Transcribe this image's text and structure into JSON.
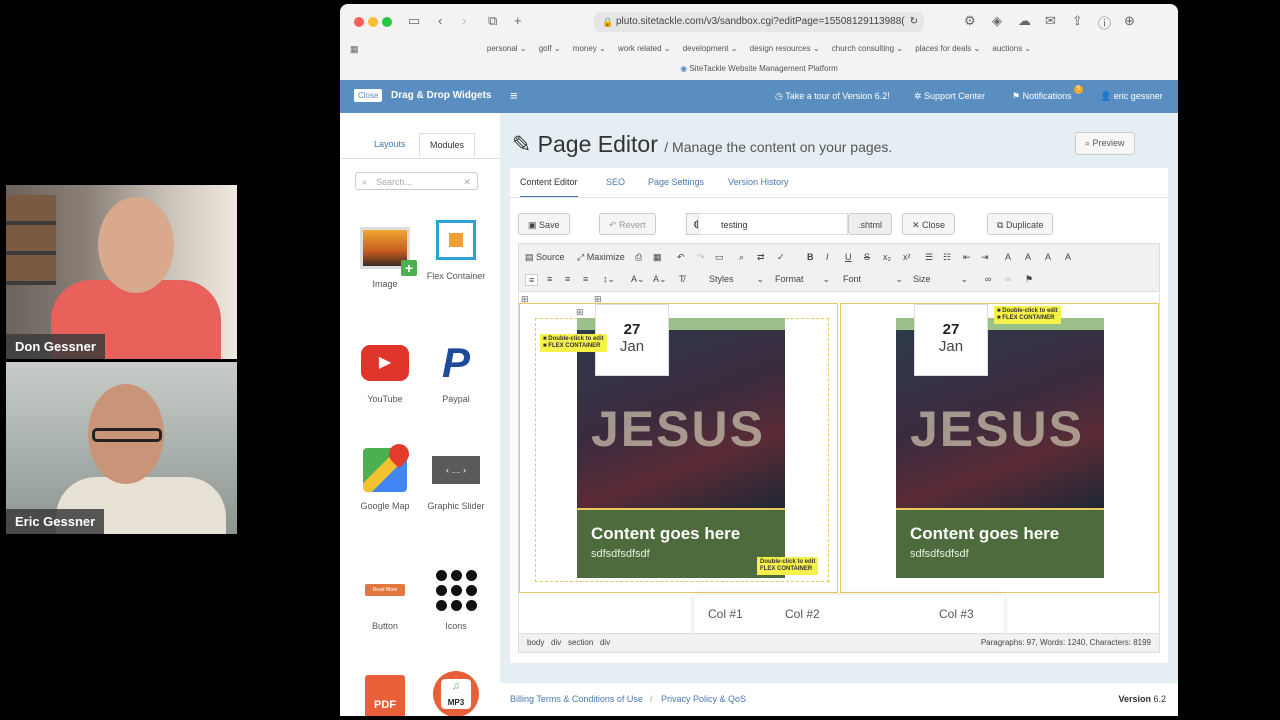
{
  "participants": [
    {
      "name": "Don Gessner"
    },
    {
      "name": "Eric Gessner"
    }
  ],
  "browser": {
    "url": "pluto.sitetackle.com/v3/sandbox.cgi?editPage=15508129113988(",
    "bookmarks": [
      "personal ⌄",
      "golf ⌄",
      "money ⌄",
      "work related ⌄",
      "development ⌄",
      "design resources ⌄",
      "church consulting ⌄",
      "places for deals ⌄",
      "auctions ⌄"
    ],
    "platform_title": "SiteTackle Website Management Platform"
  },
  "appbar": {
    "close_label": "Close",
    "title": "Drag & Drop Widgets",
    "tour": "Take a tour of Version 6.2!",
    "support": "Support Center",
    "notifications": "Notifications",
    "notif_count": "5",
    "user": "eric gessner"
  },
  "sidebar": {
    "tabs": [
      "Layouts",
      "Modules"
    ],
    "search_placeholder": "Search...",
    "modules": [
      "Image",
      "Flex Container",
      "YouTube",
      "Paypal",
      "Google Map",
      "Graphic Slider",
      "Button",
      "Icons",
      "PDF",
      "MP3"
    ],
    "button_preview_text": "Read More"
  },
  "editor": {
    "title": "Page Editor",
    "subtitle": "/ Manage the content on your pages.",
    "preview": "Preview",
    "tabs": [
      "Content Editor",
      "SEO",
      "Page Settings",
      "Version History"
    ],
    "save": "Save",
    "revert": "Revert",
    "filename": "testing",
    "extension": ".shtml",
    "close": "Close",
    "duplicate": "Duplicate",
    "toolbar": {
      "source": "Source",
      "maximize": "Maximize",
      "styles": "Styles",
      "format": "Format",
      "font": "Font",
      "size": "Size"
    },
    "cards": [
      {
        "day": "27",
        "month": "Jan",
        "image_text": "JESUS",
        "heading": "Content goes here",
        "sub": "sdfsdfsdfsdf"
      },
      {
        "day": "27",
        "month": "Jan",
        "image_text": "JESUS",
        "heading": "Content goes here",
        "sub": "sdfsdfsdfsdf"
      }
    ],
    "flex_tag_line1": "Double-click to edit",
    "flex_tag_line2": "FLEX CONTAINER",
    "columns": [
      "Col #1",
      "Col #2",
      "Col #3"
    ],
    "path": [
      "body",
      "div",
      "section",
      "div"
    ],
    "stats": "Paragraphs: 97, Words: 1240, Characters: 8199"
  },
  "footer": {
    "billing": "Billing Terms & Conditions of Use",
    "privacy": "Privacy Policy & QoS",
    "version_label": "Version",
    "version": "6.2"
  },
  "colors": {
    "appbar": "#5b8ec0",
    "card_footer": "#4d6b3c",
    "tag": "#f6f24a"
  }
}
